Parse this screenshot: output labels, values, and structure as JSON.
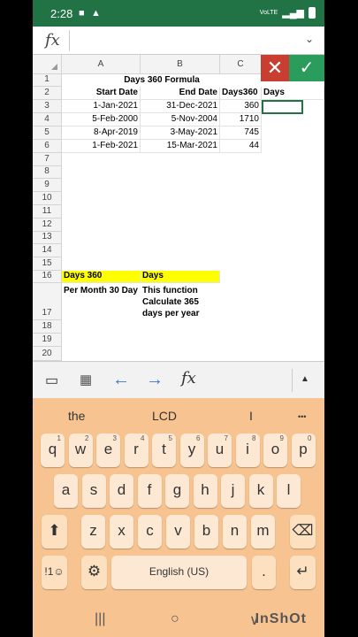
{
  "status": {
    "time": "2:28",
    "icons": [
      "video-icon",
      "warning-icon"
    ],
    "right_label": "VoLTE",
    "battery": "battery-icon"
  },
  "formula_bar": {
    "fx": "fx",
    "value": ""
  },
  "columns": [
    "A",
    "B",
    "C"
  ],
  "rows": [
    "1",
    "2",
    "3",
    "4",
    "5",
    "6",
    "7",
    "8",
    "9",
    "10",
    "11",
    "12",
    "13",
    "14",
    "15",
    "16",
    "17",
    "18",
    "19",
    "20"
  ],
  "title": "Days 360 Formula",
  "headers": {
    "a": "Start Date",
    "b": "End Date",
    "c": "Days360",
    "d": "Days"
  },
  "table": [
    {
      "start": "1-Jan-2021",
      "end": "31-Dec-2021",
      "days360": "360"
    },
    {
      "start": "5-Feb-2000",
      "end": "5-Nov-2004",
      "days360": "1710"
    },
    {
      "start": "8-Apr-2019",
      "end": "3-May-2021",
      "days360": "745"
    },
    {
      "start": "1-Feb-2021",
      "end": "15-Mar-2021",
      "days360": "44"
    }
  ],
  "notes": {
    "a16": "Days 360",
    "b16": "Days",
    "a17": "Per Month 30 Day",
    "b17": "This function Calculate 365 days per year"
  },
  "edit_buttons": {
    "cancel": "✕",
    "ok": "✓"
  },
  "toolbar": {
    "fx": "fx",
    "left": "←",
    "right": "→",
    "up": "▲"
  },
  "suggestions": [
    "the",
    "LCD",
    "I",
    "•••"
  ],
  "keys_row1": [
    {
      "l": "q",
      "n": "1"
    },
    {
      "l": "w",
      "n": "2"
    },
    {
      "l": "e",
      "n": "3"
    },
    {
      "l": "r",
      "n": "4"
    },
    {
      "l": "t",
      "n": "5"
    },
    {
      "l": "y",
      "n": "6"
    },
    {
      "l": "u",
      "n": "7"
    },
    {
      "l": "i",
      "n": "8"
    },
    {
      "l": "o",
      "n": "9"
    },
    {
      "l": "p",
      "n": "0"
    }
  ],
  "keys_row2": [
    "a",
    "s",
    "d",
    "f",
    "g",
    "h",
    "j",
    "k",
    "l"
  ],
  "keys_row3": [
    "z",
    "x",
    "c",
    "v",
    "b",
    "n",
    "m"
  ],
  "keys_row4": {
    "sym": "!1☺",
    "space": "English (US)",
    "period": ".",
    "enter": "↵"
  },
  "nav": {
    "recent": "|||",
    "home": "○",
    "back": "∨"
  },
  "watermark": "InShOt"
}
